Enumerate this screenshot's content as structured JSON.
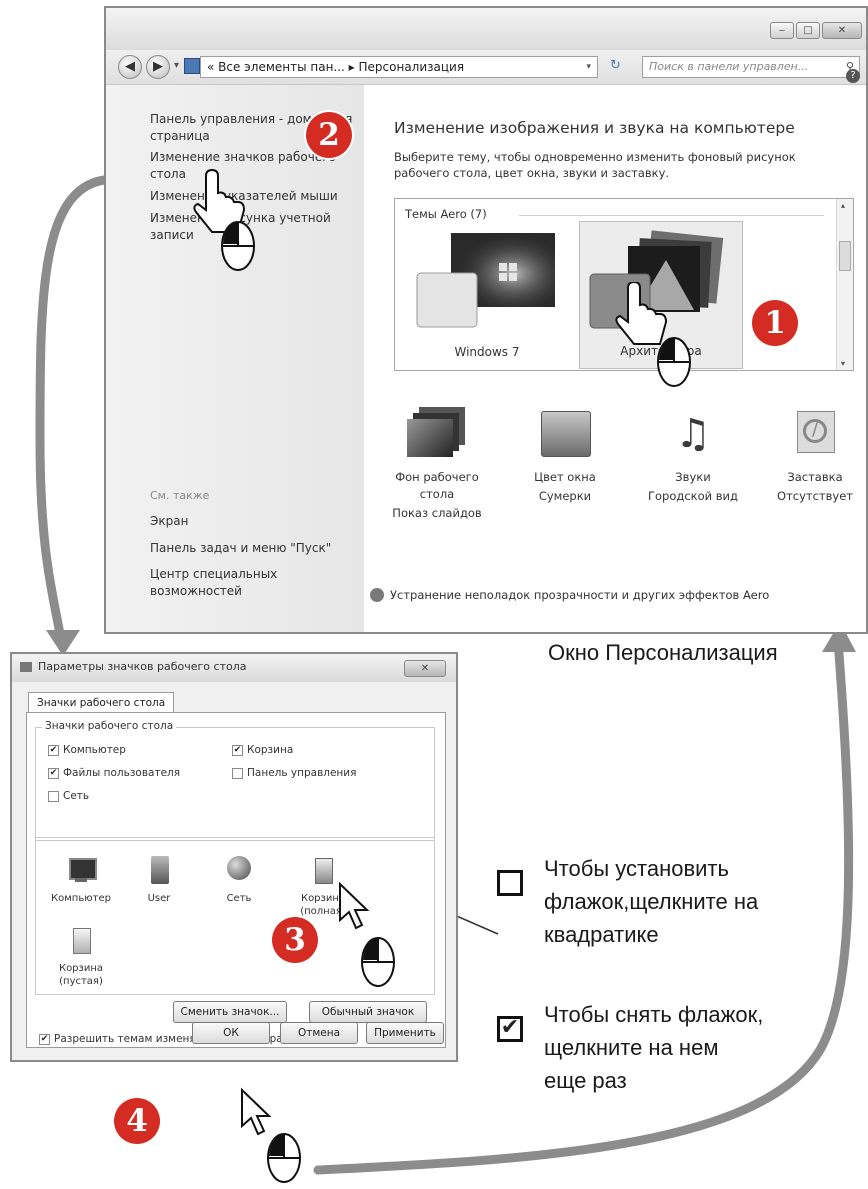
{
  "personalization": {
    "address_path": "« Все элементы пан... ▸ Персонализация",
    "search_placeholder": "Поиск в панели управлен...",
    "left_links": [
      "Панель управления - домашняя страница",
      "Изменение значков рабочего стола",
      "Изменение указателей мыши",
      "Изменение рисунка учетной записи"
    ],
    "see_also": "См. также",
    "see_also_links": [
      "Экран",
      "Панель задач и меню \"Пуск\"",
      "Центр специальных возможностей"
    ],
    "title": "Изменение изображения и звука на компьютере",
    "subtitle": "Выберите тему, чтобы одновременно изменить фоновый рисунок рабочего стола, цвет окна, звуки и заставку.",
    "themes_group": "Темы Aero (7)",
    "themes": [
      "Windows 7",
      "Архитектура"
    ],
    "bottom_items": [
      {
        "label": "Фон рабочего стола",
        "value": "Показ слайдов"
      },
      {
        "label": "Цвет окна",
        "value": "Сумерки"
      },
      {
        "label": "Звуки",
        "value": "Городской вид"
      },
      {
        "label": "Заставка",
        "value": "Отсутствует"
      }
    ],
    "troubleshoot_link": "Устранение неполадок прозрачности и других эффектов Aero"
  },
  "dialog": {
    "title": "Параметры значков рабочего стола",
    "tab": "Значки рабочего стола",
    "group": "Значки рабочего стола",
    "checkboxes": [
      {
        "label": "Компьютер",
        "checked": true
      },
      {
        "label": "Корзина",
        "checked": true
      },
      {
        "label": "Файлы пользователя",
        "checked": true
      },
      {
        "label": "Панель управления",
        "checked": false
      },
      {
        "label": "Сеть",
        "checked": false
      }
    ],
    "icons": [
      "Компьютер",
      "User",
      "Сеть",
      "Корзина (полная)",
      "Корзина (пустая)"
    ],
    "change_icon": "Сменить значок...",
    "default_icon": "Обычный значок",
    "allow_themes": "Разрешить темам изменять значки на рабочем столе",
    "ok": "ОК",
    "cancel": "Отмена",
    "apply": "Применить"
  },
  "annotations": {
    "badges": [
      "1",
      "2",
      "3",
      "4"
    ],
    "window_caption": "Окно Персонализация",
    "check_caption": "Чтобы установить флажок,щелкните на квадратике",
    "uncheck_caption": "Чтобы снять флажок, щелкните на нем еще раз",
    "accent_color": "#d42c22"
  }
}
